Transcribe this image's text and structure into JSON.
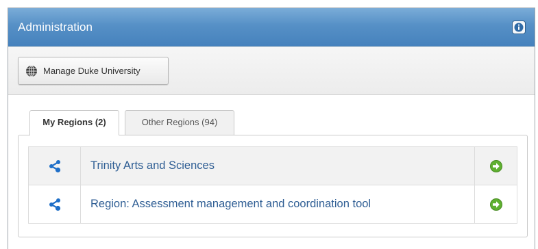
{
  "header": {
    "title": "Administration",
    "info_icon": "info-icon"
  },
  "toolbar": {
    "manage_button": {
      "label": "Manage Duke University",
      "icon": "globe-icon"
    }
  },
  "tabs": [
    {
      "label": "My Regions (2)",
      "active": true
    },
    {
      "label": "Other Regions (94)",
      "active": false
    }
  ],
  "regions": [
    {
      "name": "Trinity Arts and Sciences",
      "icon": "share-icon",
      "action_icon": "go-arrow-icon"
    },
    {
      "name": "Region: Assessment management and coordination tool",
      "icon": "share-icon",
      "action_icon": "go-arrow-icon"
    }
  ],
  "colors": {
    "header_blue": "#5690c6",
    "link_blue": "#2f5e94",
    "icon_blue": "#1f6fc8",
    "go_green": "#5fb030"
  }
}
